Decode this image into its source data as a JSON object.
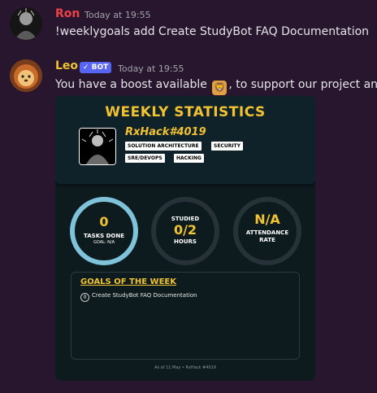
{
  "messages": [
    {
      "author": "Ron",
      "author_color": "#ed4245",
      "timestamp": "Today at 19:55",
      "content": "!weeklygoals add Create StudyBot FAQ Documentation"
    },
    {
      "author": "Leo",
      "author_color": "#f1c232",
      "badge": "✓ BOT",
      "timestamp": "Today at 19:55",
      "content_before": "You have a boost available",
      "boost_icon": "lion-emoji",
      "content_after": ", to support our project and e"
    }
  ],
  "card": {
    "title": "WEEKLY STATISTICS",
    "user": {
      "name": "RxHack",
      "discriminator": "#4019"
    },
    "tags": [
      "SOLUTION ARCHITECTURE",
      "SECURITY",
      "SRE/DEVOPS",
      "HACKING"
    ],
    "stats": [
      {
        "value": "0",
        "label": "TASKS DONE",
        "sub": "GOAL: N/A"
      },
      {
        "top": "STUDIED",
        "value": "0/2",
        "label": "HOURS"
      },
      {
        "value": "N/A",
        "label": "ATTENDANCE",
        "label2": "RATE"
      }
    ],
    "goals_title": "GOALS OF THE WEEK",
    "goals": [
      {
        "num": "0",
        "text": "Create StudyBot FAQ Documentation"
      }
    ],
    "footer": "As of 11 May • RxHack #4019"
  }
}
